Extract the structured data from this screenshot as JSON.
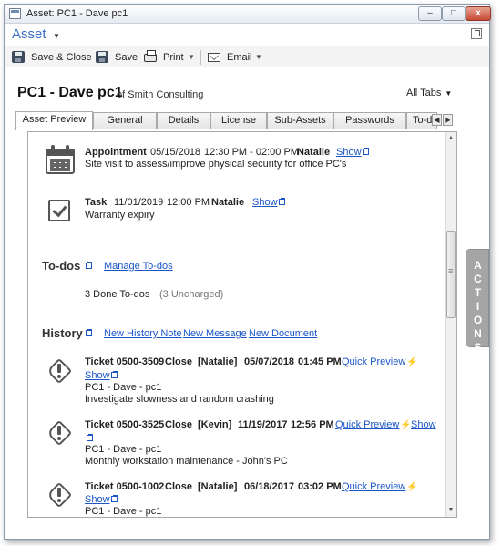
{
  "window": {
    "title": "Asset: PC1 - Dave pc1",
    "minimize": "–",
    "maximize": "□",
    "close": "x"
  },
  "header": {
    "module": "Asset"
  },
  "toolbar": {
    "save_close": "Save & Close",
    "save": "Save",
    "print": "Print",
    "email": "Email"
  },
  "asset": {
    "name": "PC1 - Dave pc1",
    "company_prefix": "of Smith Consulting",
    "all_tabs": "All Tabs"
  },
  "tabs": [
    "Asset Preview",
    "General",
    "Details",
    "License",
    "Sub-Assets",
    "Passwords",
    "To-do"
  ],
  "activities": [
    {
      "type": "Appointment",
      "date": "05/15/2018",
      "time": "12:30 PM - 02:00 PM",
      "person": "Natalie",
      "link": "Show",
      "description": "Site visit to assess/improve physical security for office PC's",
      "icon": "calendar-icon"
    },
    {
      "type": "Task",
      "date": "11/01/2019",
      "time": "12:00 PM",
      "person": "Natalie",
      "link": "Show",
      "description": "Warranty expiry",
      "icon": "checkbox-icon"
    }
  ],
  "todos": {
    "title": "To-dos",
    "manage": "Manage To-dos",
    "count_label": "3 Done To-dos",
    "uncharged": "(3 Uncharged)"
  },
  "history": {
    "title": "History",
    "actions": [
      "New History Note",
      "New Message",
      "New Document"
    ],
    "items": [
      {
        "ticket": "Ticket 0500-3509",
        "status": "Close",
        "person": "[Natalie]",
        "date": "05/07/2018",
        "time": "01:45 PM",
        "quick_preview": "Quick Preview",
        "show": "Show",
        "asset": "PC1 - Dave - pc1",
        "description": "Investigate slowness and random crashing"
      },
      {
        "ticket": "Ticket 0500-3525",
        "status": "Close",
        "person": "[Kevin]",
        "date": "11/19/2017",
        "time": "12:56 PM",
        "quick_preview": "Quick Preview",
        "show": "Show",
        "asset": "PC1 - Dave - pc1",
        "description": "Monthly workstation maintenance - John's PC"
      },
      {
        "ticket": "Ticket 0500-1002",
        "status": "Close",
        "person": "[Natalie]",
        "date": "06/18/2017",
        "time": "03:02 PM",
        "quick_preview": "Quick Preview",
        "show": "Show",
        "asset": "PC1 - Dave - pc1",
        "description": ""
      }
    ]
  },
  "actions_tab": "ACTIONS",
  "colors": {
    "link": "#1a56c8",
    "module": "#3a6fc2",
    "accent_bolt": "#f0a400",
    "actions_tab": "#a5a5a5"
  }
}
